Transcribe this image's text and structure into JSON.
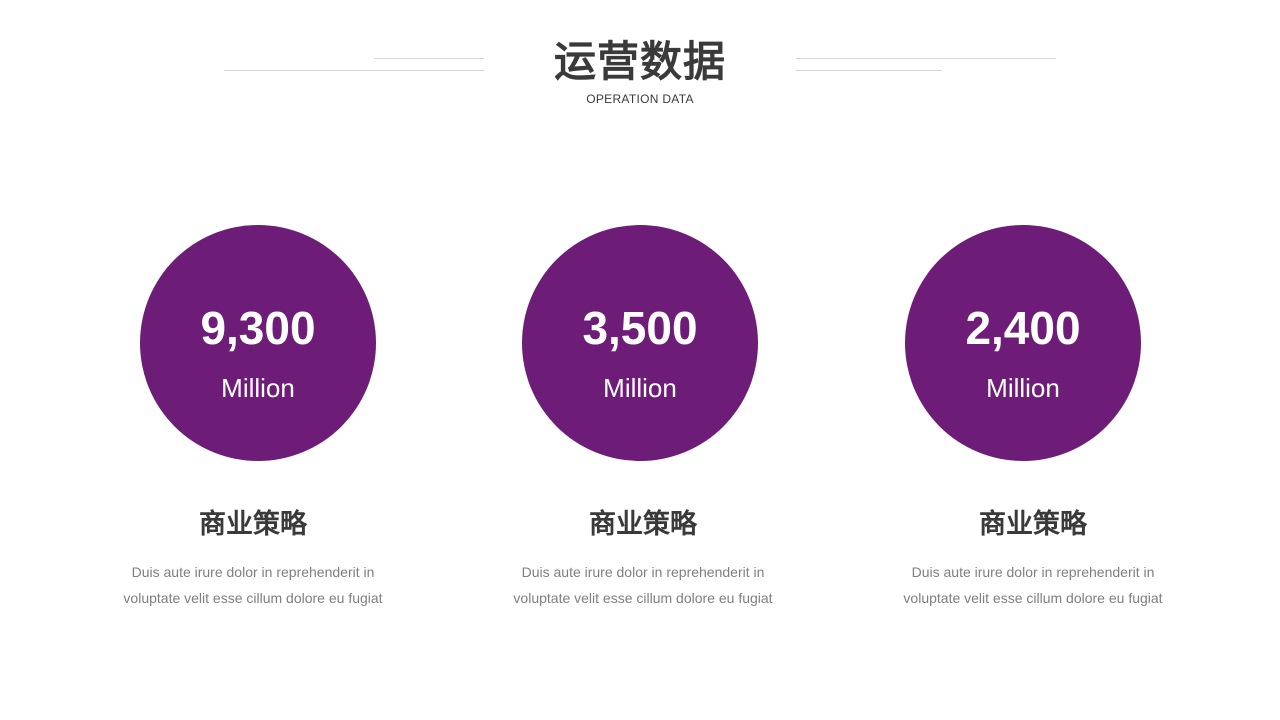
{
  "header": {
    "title": "运营数据",
    "subtitle": "OPERATION DATA"
  },
  "colors": {
    "accent": "#6d1d78",
    "title_text": "#3a3a3a",
    "body_text": "#7f7f7f",
    "rule": "#d8d8d8"
  },
  "stats": [
    {
      "value": "9,300",
      "unit": "Million",
      "heading": "商业策略",
      "body": "Duis aute irure dolor in reprehenderit in voluptate velit esse cillum dolore eu fugiat"
    },
    {
      "value": "3,500",
      "unit": "Million",
      "heading": "商业策略",
      "body": "Duis aute irure dolor in reprehenderit in voluptate velit esse cillum dolore eu fugiat"
    },
    {
      "value": "2,400",
      "unit": "Million",
      "heading": "商业策略",
      "body": "Duis aute irure dolor in reprehenderit in voluptate velit esse cillum dolore eu fugiat"
    }
  ]
}
